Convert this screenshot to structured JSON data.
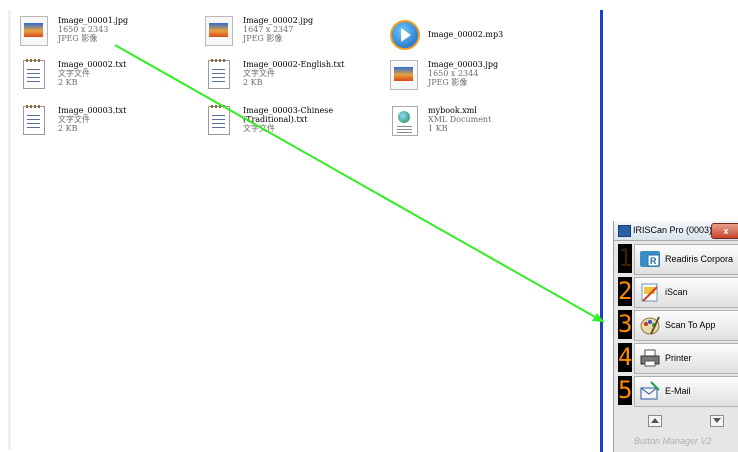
{
  "files": [
    {
      "name": "Image_00001.jpg",
      "sub1": "1650 x 2343",
      "sub2": "JPEG 影像",
      "icon": "jpeg-image-icon"
    },
    {
      "name": "Image_00002.jpg",
      "sub1": "1647 x 2347",
      "sub2": "JPEG 影像",
      "icon": "jpeg-image-icon"
    },
    {
      "name": "Image_00002.mp3",
      "sub1": "",
      "sub2": "",
      "icon": "media-player-icon"
    },
    {
      "name": "Image_00002.txt",
      "sub1": "文字文件",
      "sub2": "2 KB",
      "icon": "text-document-icon"
    },
    {
      "name": "Image_00002-English.txt",
      "sub1": "文字文件",
      "sub2": "2 KB",
      "icon": "text-document-icon"
    },
    {
      "name": "Image_00003.jpg",
      "sub1": "1650 x 2344",
      "sub2": "JPEG 影像",
      "icon": "jpeg-image-icon"
    },
    {
      "name": "Image_00003.txt",
      "sub1": "文字文件",
      "sub2": "2 KB",
      "icon": "text-document-icon"
    },
    {
      "name": "Image_00003-Chinese",
      "name2": "(Traditional).txt",
      "sub1": "文字文件",
      "sub2": "",
      "icon": "text-document-icon"
    },
    {
      "name": "mybook.xml",
      "sub1": "XML Document",
      "sub2": "1 KB",
      "icon": "xml-document-icon"
    }
  ],
  "button_manager": {
    "title": "IRISCan Pro (0003)",
    "close": "x",
    "buttons": [
      {
        "num": "1",
        "label": "Readiris Corpora",
        "icon": "readiris-icon"
      },
      {
        "num": "2",
        "label": "iScan",
        "icon": "iscan-icon"
      },
      {
        "num": "3",
        "label": "Scan To App",
        "icon": "scan-to-app-icon"
      },
      {
        "num": "4",
        "label": "Printer",
        "icon": "printer-icon"
      },
      {
        "num": "5",
        "label": "E-Mail",
        "icon": "email-icon"
      }
    ],
    "footer": "Button Manager V2"
  },
  "colors": {
    "drag_line": "#33ee22",
    "divider": "#1e3fc8",
    "led": "#ff8a00"
  }
}
